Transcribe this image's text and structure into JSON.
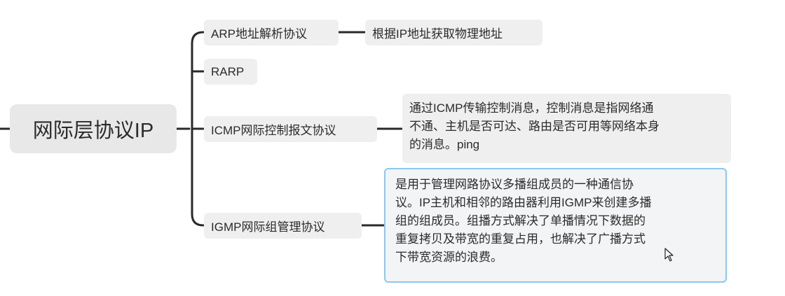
{
  "root": {
    "label": "网际层协议IP"
  },
  "branches": [
    {
      "label": "ARP地址解析协议",
      "detail": "根据IP地址获取物理地址"
    },
    {
      "label": "RARP"
    },
    {
      "label": "ICMP网际控制报文协议",
      "detail": [
        "通过ICMP传输控制消息，控制消息是指网络通",
        "不通、主机是否可达、路由是否可用等网络本身",
        "的消息。ping"
      ]
    },
    {
      "label": "IGMP网际组管理协议",
      "detail": [
        "是用于管理网路协议多播组成员的一种通信协",
        "议。IP主机和相邻的路由器利用IGMP来创建多播",
        "组的组成员。组播方式解决了单播情况下数据的",
        "重复拷贝及带宽的重复占用，也解决了广播方式",
        "下带宽资源的浪费。"
      ]
    }
  ],
  "colors": {
    "edge": "#2a2a2a",
    "node_bg": "#efefef",
    "selected_border": "#8cc8ee"
  },
  "icons": {
    "cursor": "mouse-pointer-icon"
  }
}
